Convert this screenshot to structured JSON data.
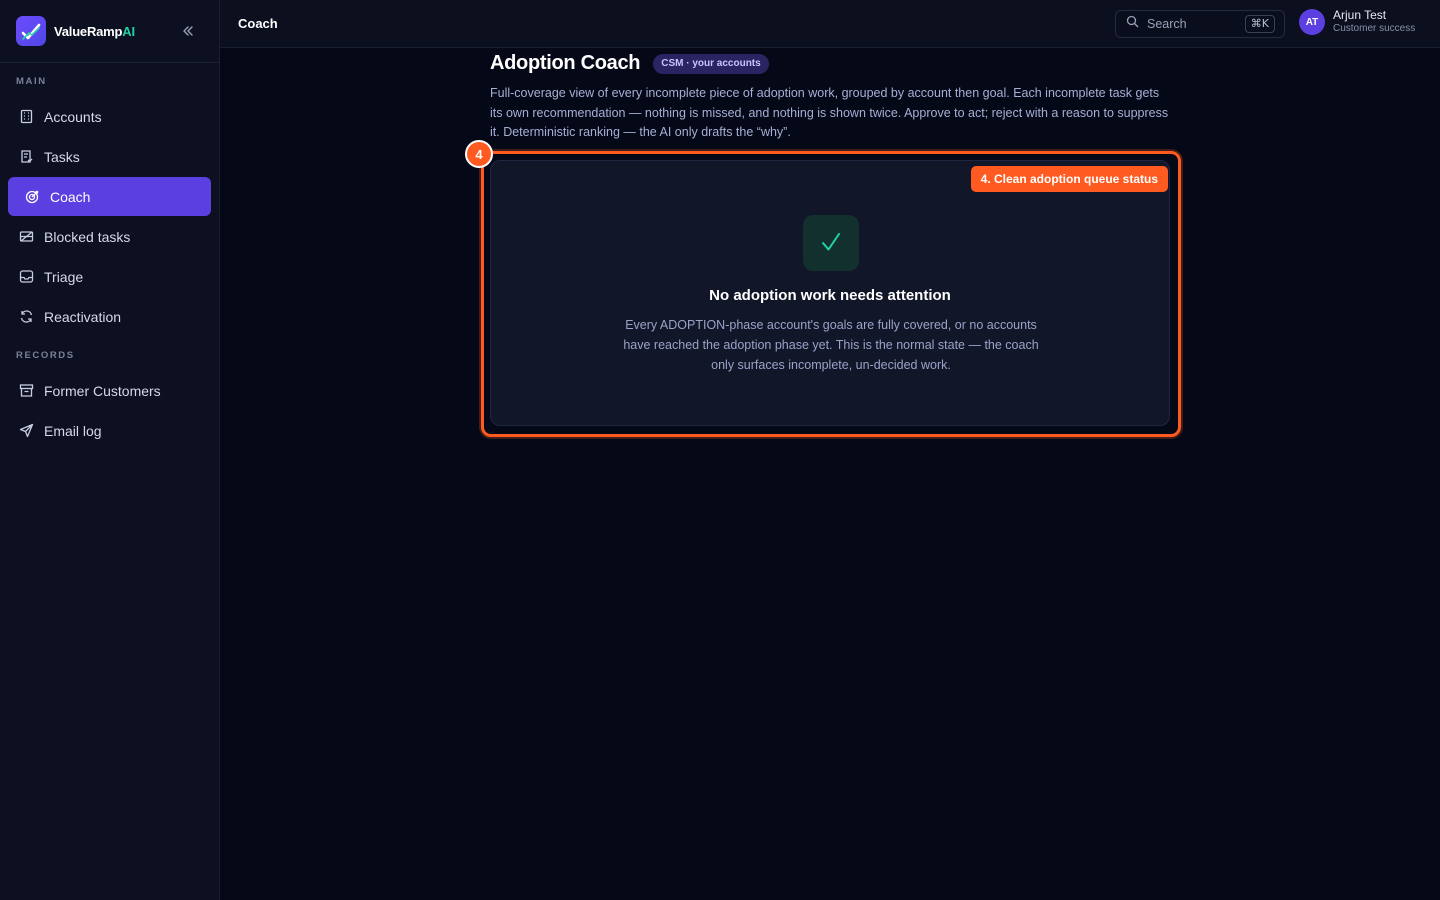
{
  "brand": {
    "name": "ValueRamp",
    "suffix": "AI"
  },
  "sidebar": {
    "main_label": "MAIN",
    "main_items": [
      {
        "label": "Accounts",
        "icon": "building-icon"
      },
      {
        "label": "Tasks",
        "icon": "clipboard-icon"
      },
      {
        "label": "Coach",
        "icon": "target-icon",
        "active": true
      },
      {
        "label": "Blocked tasks",
        "icon": "blocked-icon"
      },
      {
        "label": "Triage",
        "icon": "inbox-icon"
      },
      {
        "label": "Reactivation",
        "icon": "refresh-icon"
      }
    ],
    "records_label": "RECORDS",
    "records_items": [
      {
        "label": "Former Customers",
        "icon": "archive-icon"
      },
      {
        "label": "Email log",
        "icon": "send-icon"
      }
    ]
  },
  "topbar": {
    "title": "Coach",
    "search_placeholder": "Search",
    "shortcut": "⌘K",
    "user": {
      "initials": "AT",
      "name": "Arjun Test",
      "role": "Customer success"
    }
  },
  "page": {
    "title": "Adoption Coach",
    "badge": "CSM · your accounts",
    "description": "Full-coverage view of every incomplete piece of adoption work, grouped by account then goal. Each incomplete task gets its own recommendation — nothing is missed, and nothing is shown twice. Approve to act; reject with a reason to suppress it. Deterministic ranking — the AI only drafts the “why”.",
    "annotation": {
      "number": "4",
      "label": "4. Clean adoption queue status"
    },
    "empty_state": {
      "title": "No adoption work needs attention",
      "text": "Every ADOPTION-phase account's goals are fully covered, or no accounts have reached the adoption phase yet. This is the normal state — the coach only surfaces incomplete, un-decided work."
    }
  },
  "colors": {
    "accent": "#5b3fe0",
    "highlight": "#ff5a1f",
    "success": "#22d3a6",
    "background": "#050816"
  }
}
